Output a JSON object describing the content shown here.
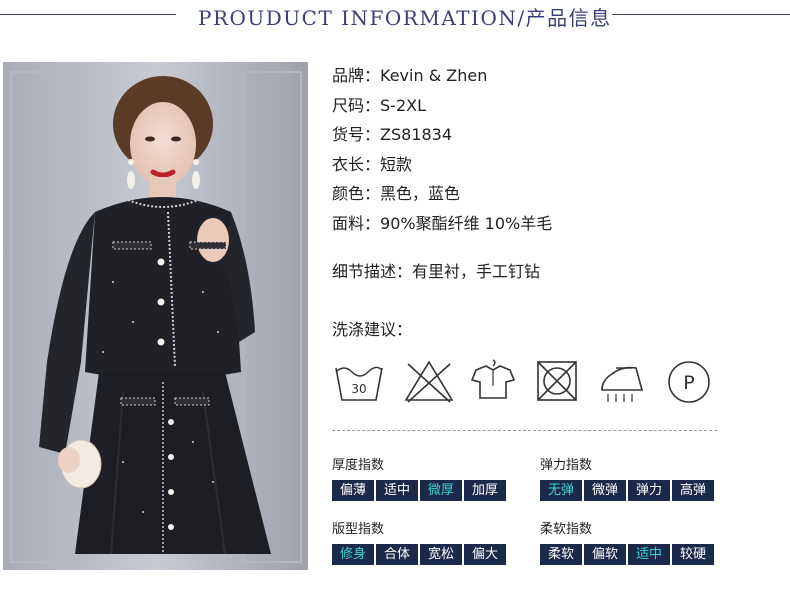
{
  "header": {
    "title": "PROUDUCT INFORMATION/产品信息"
  },
  "product_image": {
    "alt": "model wearing black tweed jacket and skirt"
  },
  "specs": [
    {
      "label": "品牌：",
      "value": "Kevin & Zhen"
    },
    {
      "label": "尺码：",
      "value": "S-2XL"
    },
    {
      "label": "货号：",
      "value": "ZS81834"
    },
    {
      "label": "衣长：",
      "value": "短款"
    },
    {
      "label": "颜色：",
      "value": "黑色，蓝色"
    },
    {
      "label": "面料：",
      "value": "90%聚酯纤维 10%羊毛"
    }
  ],
  "detail": {
    "label": "细节描述：",
    "value": "有里衬，手工钉钻"
  },
  "care": {
    "title": "洗涤建议：",
    "wash_temp": "30",
    "dryclean_letter": "P",
    "icons": [
      "wash-30-icon",
      "no-bleach-icon",
      "hang-dry-icon",
      "no-tumble-dry-icon",
      "iron-icon",
      "dry-clean-p-icon"
    ]
  },
  "scales": {
    "thickness": {
      "label": "厚度指数",
      "options": [
        "偏薄",
        "适中",
        "微厚",
        "加厚"
      ],
      "selected": 2
    },
    "elasticity": {
      "label": "弹力指数",
      "options": [
        "无弹",
        "微弹",
        "弹力",
        "高弹"
      ],
      "selected": 0
    },
    "fit": {
      "label": "版型指数",
      "options": [
        "修身",
        "合体",
        "宽松",
        "偏大"
      ],
      "selected": 0
    },
    "softness": {
      "label": "柔软指数",
      "options": [
        "柔软",
        "偏软",
        "适中",
        "较硬"
      ],
      "selected": 2
    }
  },
  "colors": {
    "accent": "#3a3f7a",
    "tag_bg": "#1b2a4a",
    "tag_selected_text": "#3fd0d4"
  }
}
